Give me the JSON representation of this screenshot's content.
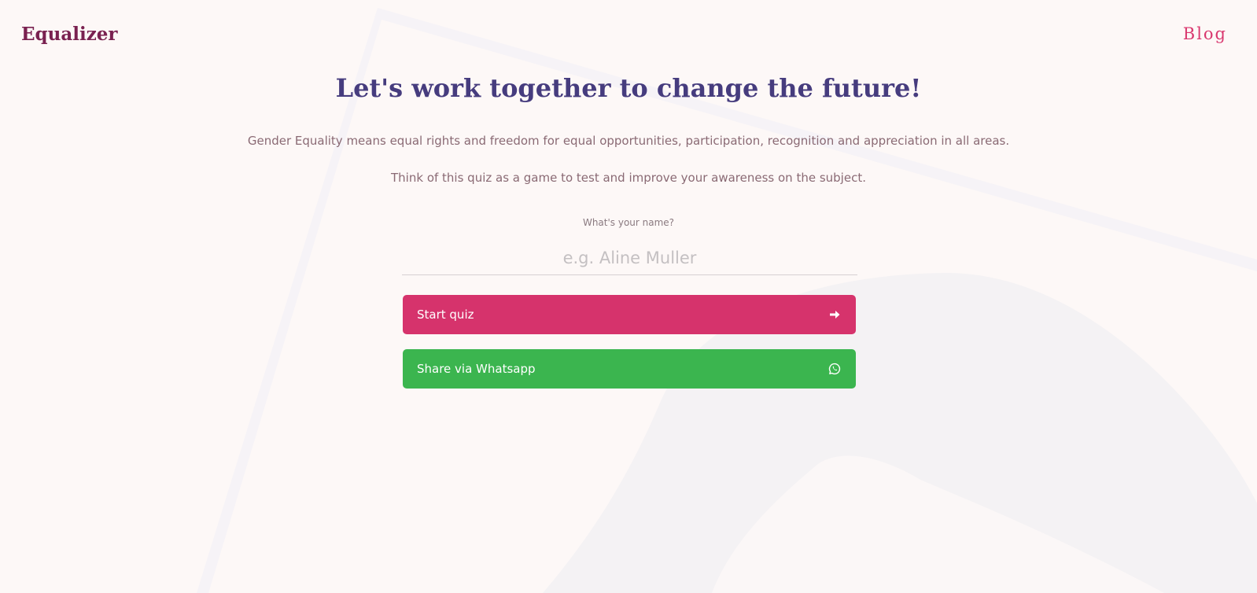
{
  "header": {
    "logo": "Equalizer",
    "blog_link": "Blog"
  },
  "hero": {
    "title": "Let's work together to change the future!",
    "description_1": "Gender Equality means equal rights and freedom for equal opportunities, participation, recognition and appreciation in all areas.",
    "description_2": "Think of this quiz as a game to test and improve your awareness on the subject."
  },
  "form": {
    "name_label": "What's your name?",
    "name_placeholder": "e.g. Aline Muller",
    "name_value": "",
    "start_button": {
      "label": "Start quiz",
      "icon": "arrow-right-icon"
    },
    "share_button": {
      "label": "Share via Whatsapp",
      "icon": "whatsapp-icon"
    }
  },
  "colors": {
    "background": "#fdf8f7",
    "logo": "#7a2150",
    "blog_link": "#d9376e",
    "title": "#463c7e",
    "start_button": "#d6336c",
    "share_button": "#3bb54f"
  }
}
